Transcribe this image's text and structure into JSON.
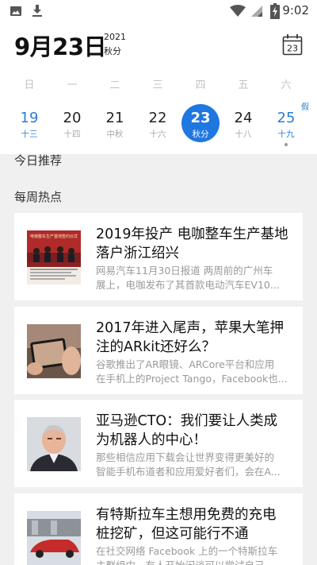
{
  "status_bar": {
    "time": "9:02",
    "icons": [
      "image-icon",
      "download-icon",
      "wifi-icon",
      "signal-icon",
      "battery-charging-icon"
    ]
  },
  "header": {
    "date": "9月23日",
    "year": "2021",
    "solar_term": "秋分",
    "calendar_button_day": "23"
  },
  "weekdays": [
    "日",
    "一",
    "二",
    "三",
    "四",
    "五",
    "六"
  ],
  "days": [
    {
      "num": "19",
      "lunar": "十三",
      "weekend": true
    },
    {
      "num": "20",
      "lunar": "十四"
    },
    {
      "num": "21",
      "lunar": "中秋"
    },
    {
      "num": "22",
      "lunar": "十六"
    },
    {
      "num": "23",
      "lunar": "秋分",
      "selected": true
    },
    {
      "num": "24",
      "lunar": "十八"
    },
    {
      "num": "25",
      "lunar": "十九",
      "weekend": true,
      "tag": "假",
      "has_event": true
    }
  ],
  "sections": {
    "today": "今日推荐",
    "weekly": "每周热点"
  },
  "articles": [
    {
      "title_lines": [
        "2019年投产 电咖整车生产基地",
        "落户浙江绍兴"
      ],
      "desc_lines": [
        "网易汽车11月30日报道 两周前的广州车",
        "展上，电咖发布了其首款电动汽车EV10..."
      ],
      "thumb": "signing-ceremony-photo",
      "thumb_caption": "电咖整车生产基地签约仪式"
    },
    {
      "title_lines": [
        "2017年进入尾声，苹果大笔押",
        "注的ARkit还好么？"
      ],
      "desc_lines": [
        "谷歌推出了AR眼镜、ARCore平台和应用",
        "在手机上的Project Tango，Facebook也..."
      ],
      "thumb": "tablet-ar-photo"
    },
    {
      "title_lines": [
        "亚马逊CTO：我们要让人类成",
        "为机器人的中心！"
      ],
      "desc_lines": [
        "那些相信应用下载会让世界变得更美好的",
        "智能手机布道者和应用爱好者们，会在A..."
      ],
      "thumb": "executive-portrait-photo"
    },
    {
      "title_lines": [
        "有特斯拉车主想用免费的充电",
        "桩挖矿，但这可能行不通"
      ],
      "desc_lines": [
        "在社交网络 Facebook 上的一个特斯拉车",
        "主群组中，有人开始闲谈可以尝试自己"
      ],
      "thumb": "tesla-charging-photo"
    }
  ],
  "colors": {
    "accent": "#1f77e0",
    "weekend": "#2a7ed6",
    "background": "#f0f0f0"
  }
}
